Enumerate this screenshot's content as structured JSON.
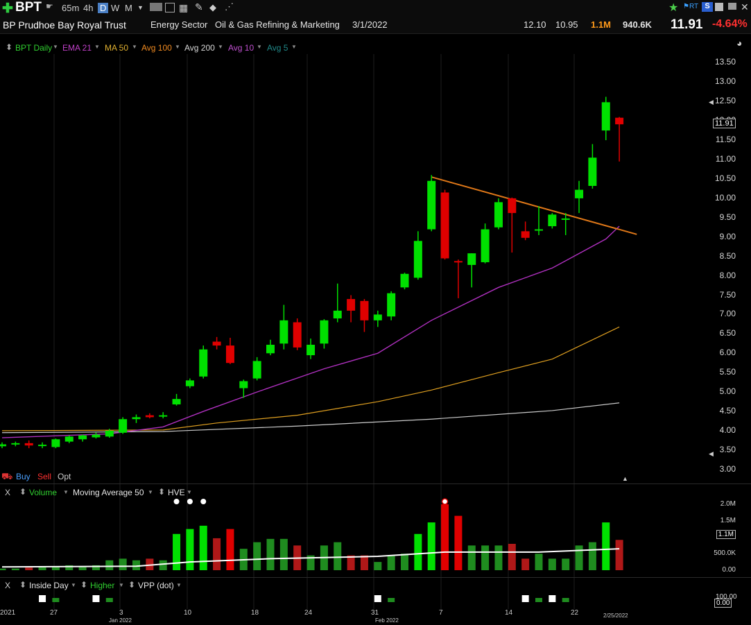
{
  "toolbar": {
    "symbol": "BPT",
    "intervals": [
      "65m",
      "4h",
      "D",
      "W",
      "M"
    ],
    "active_interval": "D"
  },
  "info": {
    "name": "BP Prudhoe Bay Royal Trust",
    "sector": "Energy Sector",
    "industry": "Oil & Gas Refining & Marketing",
    "date": "3/1/2022",
    "high": "12.10",
    "low": "10.95",
    "volume": "1.1M",
    "avg_volume": "940.6K",
    "last": "11.91",
    "change": "-4.64%"
  },
  "colors": {
    "up": "#00e000",
    "down": "#e00000",
    "ema21": "#b030c0",
    "ma50": "#e0a020",
    "ma200": "#cccccc",
    "trendline": "#e07818"
  },
  "price_legend": [
    {
      "label": "BPT Daily",
      "color": "#30d030"
    },
    {
      "label": "EMA 21",
      "color": "#c040c8"
    },
    {
      "label": "MA 50",
      "color": "#e0b030"
    },
    {
      "label": "Avg 100",
      "color": "#f08a20"
    },
    {
      "label": "Avg 200",
      "color": "#d8d8d8"
    },
    {
      "label": "Avg 10",
      "color": "#c050d0"
    },
    {
      "label": "Avg 5",
      "color": "#208a8a"
    }
  ],
  "order_buttons": {
    "buy": "Buy",
    "sell": "Sell",
    "opt": "Opt"
  },
  "volume_legend": {
    "close": "X",
    "volume": "Volume",
    "ma": "Moving Average 50",
    "hve": "HVE"
  },
  "indicator_legend": {
    "close": "X",
    "inside_day": "Inside Day",
    "higher": "Higher",
    "vpp": "VPP (dot)"
  },
  "chart_data": {
    "type": "candlestick",
    "price_axis": [
      "13.50",
      "13.00",
      "12.50",
      "12.00",
      "11.50",
      "11.00",
      "10.50",
      "10.00",
      "9.50",
      "9.00",
      "8.50",
      "8.00",
      "7.50",
      "7.00",
      "6.50",
      "6.00",
      "5.50",
      "5.00",
      "4.50",
      "4.00",
      "3.50",
      "3.00"
    ],
    "ylim": [
      3.0,
      13.5
    ],
    "current_price_label": "11.91",
    "volume_axis": [
      "2.0M",
      "1.5M",
      "1.1M",
      "500.0K",
      "0.00"
    ],
    "indicator_axis": [
      "100.00",
      "0.00"
    ],
    "date_labels": [
      "2021",
      "27",
      "Jan 2022",
      "3",
      "10",
      "18",
      "24",
      "31",
      "Feb 2022",
      "7",
      "14",
      "22",
      "2/25/2022"
    ],
    "candles": [
      {
        "o": 3.6,
        "h": 3.7,
        "l": 3.55,
        "c": 3.65
      },
      {
        "o": 3.65,
        "h": 3.72,
        "l": 3.6,
        "c": 3.68
      },
      {
        "o": 3.68,
        "h": 3.75,
        "l": 3.55,
        "c": 3.62
      },
      {
        "o": 3.62,
        "h": 3.7,
        "l": 3.55,
        "c": 3.64
      },
      {
        "o": 3.58,
        "h": 3.8,
        "l": 3.55,
        "c": 3.78
      },
      {
        "o": 3.72,
        "h": 3.88,
        "l": 3.68,
        "c": 3.85
      },
      {
        "o": 3.78,
        "h": 3.9,
        "l": 3.72,
        "c": 3.88
      },
      {
        "o": 3.83,
        "h": 3.95,
        "l": 3.8,
        "c": 3.9
      },
      {
        "o": 3.85,
        "h": 4.05,
        "l": 3.82,
        "c": 4.0
      },
      {
        "o": 3.95,
        "h": 4.35,
        "l": 3.92,
        "c": 4.3
      },
      {
        "o": 4.3,
        "h": 4.42,
        "l": 4.2,
        "c": 4.35
      },
      {
        "o": 4.4,
        "h": 4.45,
        "l": 4.32,
        "c": 4.35
      },
      {
        "o": 4.38,
        "h": 4.48,
        "l": 4.32,
        "c": 4.4
      },
      {
        "o": 4.68,
        "h": 4.95,
        "l": 4.65,
        "c": 4.82
      },
      {
        "o": 5.15,
        "h": 5.35,
        "l": 5.1,
        "c": 5.3
      },
      {
        "o": 5.4,
        "h": 6.2,
        "l": 5.35,
        "c": 6.1
      },
      {
        "o": 6.3,
        "h": 6.42,
        "l": 6.1,
        "c": 6.2
      },
      {
        "o": 6.2,
        "h": 6.4,
        "l": 5.72,
        "c": 5.75
      },
      {
        "o": 5.1,
        "h": 5.32,
        "l": 4.85,
        "c": 5.28
      },
      {
        "o": 5.35,
        "h": 5.9,
        "l": 5.3,
        "c": 5.8
      },
      {
        "o": 6.0,
        "h": 6.35,
        "l": 5.95,
        "c": 6.22
      },
      {
        "o": 6.25,
        "h": 7.25,
        "l": 6.1,
        "c": 6.85
      },
      {
        "o": 6.8,
        "h": 6.9,
        "l": 6.08,
        "c": 6.15
      },
      {
        "o": 5.95,
        "h": 6.38,
        "l": 5.85,
        "c": 6.22
      },
      {
        "o": 6.25,
        "h": 6.88,
        "l": 6.12,
        "c": 6.85
      },
      {
        "o": 6.9,
        "h": 7.8,
        "l": 6.8,
        "c": 7.1
      },
      {
        "o": 7.4,
        "h": 7.5,
        "l": 6.8,
        "c": 7.1
      },
      {
        "o": 7.35,
        "h": 7.4,
        "l": 6.55,
        "c": 6.85
      },
      {
        "o": 6.85,
        "h": 7.1,
        "l": 6.68,
        "c": 7.0
      },
      {
        "o": 6.95,
        "h": 7.6,
        "l": 6.85,
        "c": 7.55
      },
      {
        "o": 7.7,
        "h": 8.08,
        "l": 7.65,
        "c": 8.05
      },
      {
        "o": 7.95,
        "h": 9.15,
        "l": 7.9,
        "c": 8.9
      },
      {
        "o": 9.2,
        "h": 10.6,
        "l": 9.15,
        "c": 10.45
      },
      {
        "o": 10.15,
        "h": 10.22,
        "l": 8.42,
        "c": 8.45
      },
      {
        "o": 8.38,
        "h": 8.42,
        "l": 7.42,
        "c": 8.35
      },
      {
        "o": 8.28,
        "h": 8.58,
        "l": 7.7,
        "c": 8.58
      },
      {
        "o": 8.35,
        "h": 9.35,
        "l": 8.32,
        "c": 9.2
      },
      {
        "o": 9.25,
        "h": 10.0,
        "l": 9.2,
        "c": 9.9
      },
      {
        "o": 10.0,
        "h": 10.02,
        "l": 8.6,
        "c": 9.62
      },
      {
        "o": 9.15,
        "h": 9.4,
        "l": 8.92,
        "c": 8.98
      },
      {
        "o": 9.18,
        "h": 9.8,
        "l": 9.05,
        "c": 9.2
      },
      {
        "o": 9.28,
        "h": 9.62,
        "l": 9.22,
        "c": 9.58
      },
      {
        "o": 9.45,
        "h": 9.62,
        "l": 9.05,
        "c": 9.48
      },
      {
        "o": 10.0,
        "h": 10.45,
        "l": 9.62,
        "c": 10.22
      },
      {
        "o": 10.32,
        "h": 11.4,
        "l": 10.25,
        "c": 11.05
      },
      {
        "o": 11.75,
        "h": 12.62,
        "l": 11.5,
        "c": 12.48
      },
      {
        "o": 12.08,
        "h": 12.1,
        "l": 10.95,
        "c": 11.91
      }
    ],
    "ema21": [
      [
        0,
        3.82
      ],
      [
        8,
        3.92
      ],
      [
        12,
        4.1
      ],
      [
        15,
        4.5
      ],
      [
        19,
        5.0
      ],
      [
        24,
        5.6
      ],
      [
        28,
        6.0
      ],
      [
        32,
        6.85
      ],
      [
        37,
        7.7
      ],
      [
        41,
        8.2
      ],
      [
        45,
        8.95
      ],
      [
        46,
        9.28
      ]
    ],
    "ma50": [
      [
        0,
        4.0
      ],
      [
        12,
        4.02
      ],
      [
        16,
        4.2
      ],
      [
        22,
        4.4
      ],
      [
        28,
        4.75
      ],
      [
        32,
        5.05
      ],
      [
        37,
        5.5
      ],
      [
        41,
        5.85
      ],
      [
        46,
        6.68
      ]
    ],
    "ma200": [
      [
        0,
        3.95
      ],
      [
        12,
        3.98
      ],
      [
        22,
        4.12
      ],
      [
        32,
        4.3
      ],
      [
        41,
        4.52
      ],
      [
        46,
        4.72
      ]
    ],
    "trendline": [
      [
        32,
        10.55
      ],
      [
        47.3,
        9.07
      ]
    ],
    "volume": [
      0.05,
      0.05,
      0.08,
      0.1,
      0.12,
      0.15,
      0.12,
      0.15,
      0.3,
      0.35,
      0.3,
      0.35,
      0.3,
      1.1,
      1.25,
      1.35,
      0.97,
      1.25,
      0.65,
      0.85,
      0.95,
      0.95,
      0.75,
      0.45,
      0.75,
      0.85,
      0.45,
      0.45,
      0.25,
      0.45,
      0.5,
      1.1,
      1.45,
      2.0,
      1.65,
      0.75,
      0.75,
      0.75,
      0.8,
      0.35,
      0.5,
      0.35,
      0.35,
      0.75,
      0.85,
      1.45,
      0.92
    ],
    "volume_ma": [
      [
        0,
        0.1
      ],
      [
        10,
        0.12
      ],
      [
        14,
        0.25
      ],
      [
        20,
        0.35
      ],
      [
        28,
        0.42
      ],
      [
        33,
        0.55
      ],
      [
        40,
        0.55
      ],
      [
        46,
        0.65
      ]
    ]
  }
}
